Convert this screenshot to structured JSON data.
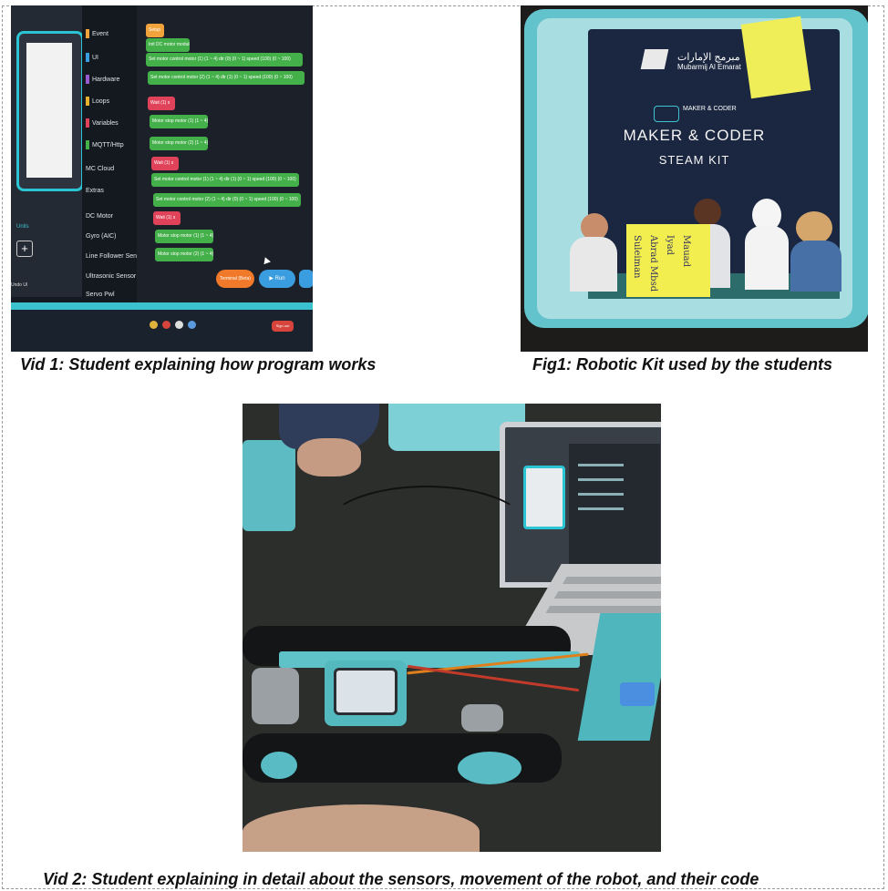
{
  "captions": {
    "vid1": "Vid 1: Student explaining how program works",
    "fig1": "Fig1: Robotic Kit used by the students",
    "vid2": "Vid 2: Student explaining in detail about the sensors, movement of the robot, and their code"
  },
  "photo1": {
    "categories": [
      "Event",
      "UI",
      "Hardware",
      "Loops",
      "Variables",
      "MQTT/Http",
      "MC Cloud",
      "Extras",
      "DC Motor",
      "Gyro (AIC)",
      "Line Follower Sensor",
      "Ultrasonic Sensor",
      "Servo Pwl"
    ],
    "side_labels": [
      "Units",
      "Undo UI"
    ],
    "blocks": [
      "Setup",
      "Init DC motor module",
      "Set motor control motor (1) (1 ~ 4) dir (0) (0 ~ 1) speed (100) (0 ~ 100)",
      "Set motor control motor (2) (1 ~ 4) dir (1) (0 ~ 1) speed (100) (0 ~ 100)",
      "Wait (1) s",
      "Motor stop motor (1) (1 ~ 4)",
      "Motor stop motor (2) (1 ~ 4)",
      "Wait (1) s",
      "Set motor control motor (1) (1 ~ 4) dir (1) (0 ~ 1) speed (100) (0 ~ 100)",
      "Set motor control motor (2) (1 ~ 4) dir (0) (0 ~ 1) speed (100) (0 ~ 100)",
      "Wait (1) s",
      "Motor stop motor (1) (1 ~ 4)",
      "Motor stop motor (2) (1 ~ 4)"
    ],
    "terminal_label": "Terminal (Beta)",
    "run_label": "Run",
    "sign_label": "Sign out"
  },
  "photo2": {
    "logo_arabic": "مبرمج الإمارات",
    "logo_latin": "Mubarmij Al Emarat",
    "brand_small": "MAKER & CODER",
    "title": "MAKER & CODER",
    "subtitle": "STEAM KIT",
    "note_lines": [
      "Mauad",
      "Iyad",
      "Abrad Mbsd",
      "Suleiman"
    ]
  },
  "colors": {
    "accent": "#2bc4d2",
    "block_green": "#44b04a",
    "block_red": "#e0425a"
  }
}
